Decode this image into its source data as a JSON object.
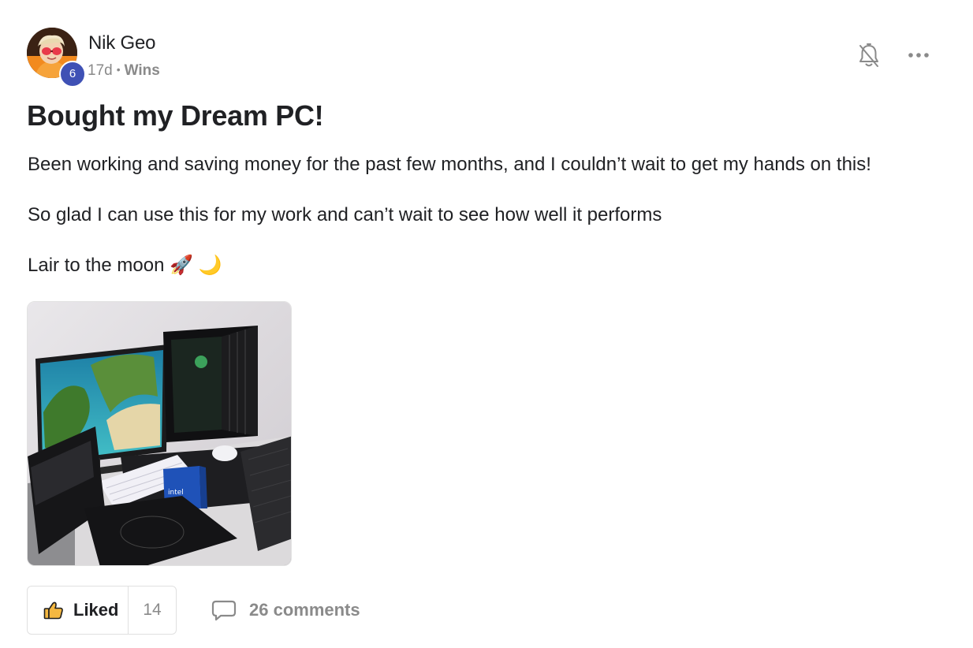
{
  "post": {
    "author": {
      "name": "Nik Geo",
      "level": "6"
    },
    "meta": {
      "age": "17d",
      "separator": "•",
      "category": "Wins"
    },
    "title": "Bought my Dream PC!",
    "paragraphs": [
      "Been working and saving money for the past few months, and I couldn’t wait to get my hands on this!",
      "So glad I can use this for my work and can’t wait to see how well it performs",
      "Lair to the moon 🚀 🌙"
    ],
    "actions": {
      "like_label": "Liked",
      "like_count": "14",
      "comments_label": "26 comments"
    },
    "icons": {
      "notification": "bell-slash-icon",
      "more": "more-horizontal-icon",
      "like": "thumbs-up-icon",
      "comment": "comment-bubble-icon"
    },
    "colors": {
      "level_badge": "#3f51b5",
      "muted_text": "#8a8a8a",
      "like_icon": "#f5b841"
    }
  }
}
